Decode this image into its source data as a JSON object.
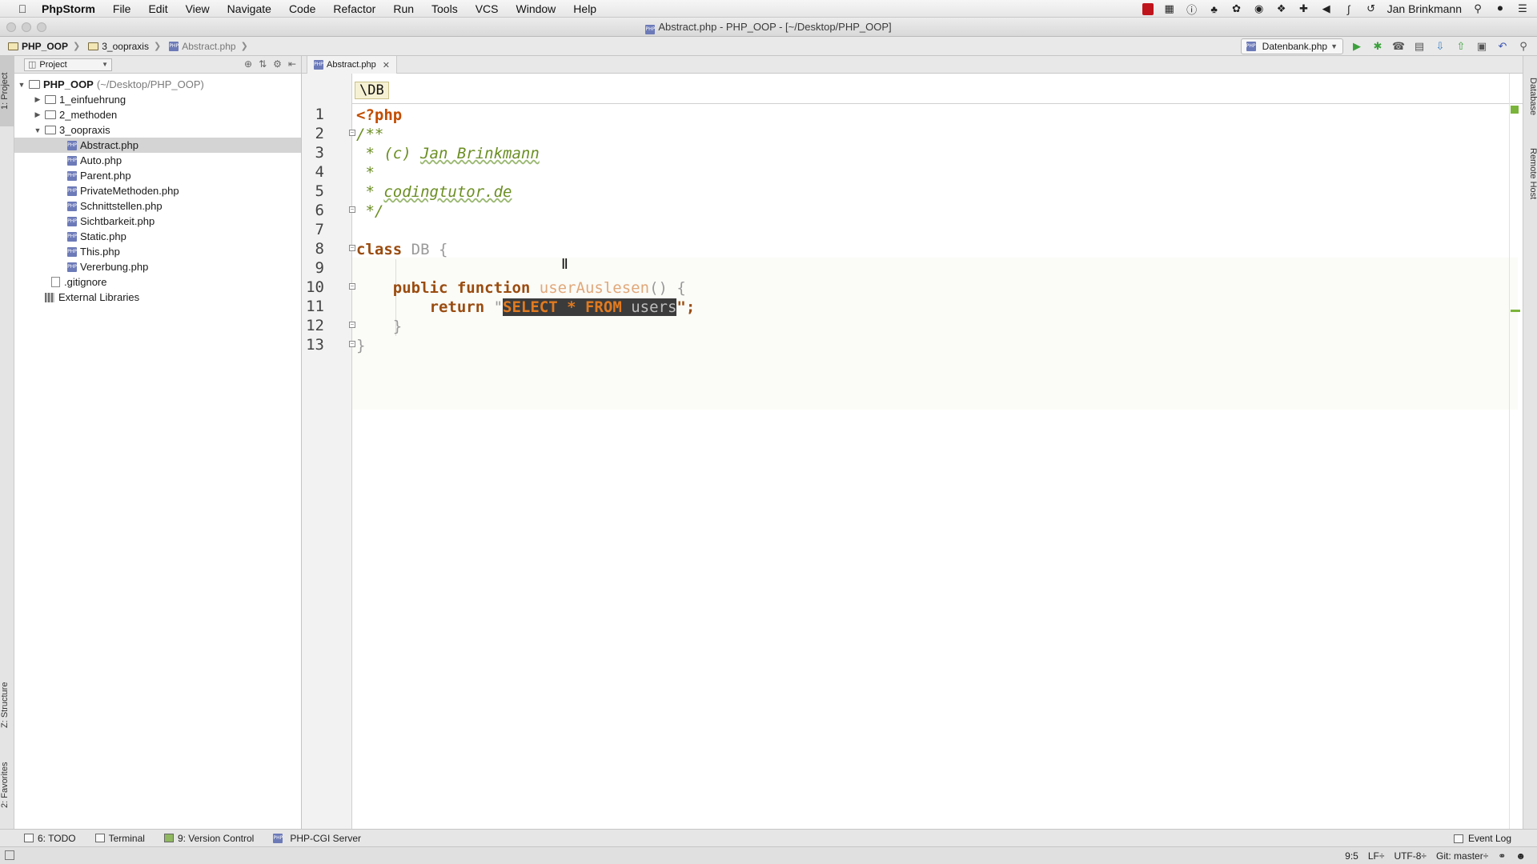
{
  "menubar": {
    "app_name": "PhpStorm",
    "items": [
      "File",
      "Edit",
      "View",
      "Navigate",
      "Code",
      "Refactor",
      "Run",
      "Tools",
      "VCS",
      "Window",
      "Help"
    ],
    "user": "Jan Brinkmann"
  },
  "window": {
    "title": "Abstract.php - PHP_OOP - [~/Desktop/PHP_OOP]"
  },
  "navbar": {
    "breadcrumb": [
      "PHP_OOP",
      "3_oopraxis",
      "Abstract.php"
    ],
    "run_config": "Datenbank.php"
  },
  "tool_windows": {
    "left_top": "1: Project",
    "left_structure": "Z: Structure",
    "left_favorites": "2: Favorites",
    "right_database": "Database",
    "right_remote": "Remote Host"
  },
  "project_panel": {
    "view_selector": "Project",
    "root_name": "PHP_OOP",
    "root_path": "(~/Desktop/PHP_OOP)",
    "folders": [
      "1_einfuehrung",
      "2_methoden",
      "3_oopraxis"
    ],
    "files": [
      "Abstract.php",
      "Auto.php",
      "Parent.php",
      "PrivateMethoden.php",
      "Schnittstellen.php",
      "Sichtbarkeit.php",
      "Static.php",
      "This.php",
      "Vererbung.php"
    ],
    "gitignore": ".gitignore",
    "external_libraries": "External Libraries"
  },
  "editor": {
    "tab_label": "Abstract.php",
    "scope_breadcrumb": "\\DB",
    "line_numbers": [
      "1",
      "2",
      "3",
      "4",
      "5",
      "6",
      "7",
      "8",
      "9",
      "10",
      "11",
      "12",
      "13"
    ],
    "code": {
      "l1": "<?php",
      "l2": "/**",
      "l3_prefix": " * (c) ",
      "l3_name": "Jan Brinkmann",
      "l4": " *",
      "l5_prefix": " * ",
      "l5_site": "codingtutor.de",
      "l6": " */",
      "l8_kw": "class",
      "l8_name": " DB",
      "l8_brace": " {",
      "l10_kw": "    public function",
      "l10_fn": " userAuslesen",
      "l10_rest": "() {",
      "l11_kw": "        return",
      "l11_q1": " \"",
      "l11_sql": "SELECT * FROM",
      "l11_tbl": " users",
      "l11_q2": "\";",
      "l12": "    }",
      "l13": "}"
    }
  },
  "bottom_bar": {
    "todo": "6: TODO",
    "terminal": "Terminal",
    "version_control": "9: Version Control",
    "php_cgi": "PHP-CGI Server",
    "event_log": "Event Log"
  },
  "status_bar": {
    "position": "9:5",
    "line_sep": "LF÷",
    "encoding": "UTF-8÷",
    "vcs": "Git: master÷"
  },
  "colors": {
    "php_open_tag": "#c24d00",
    "comment": "#6b8e23",
    "keyword": "#9a4c10",
    "sql_highlight_bg": "#3b3b3b",
    "sql_keyword": "#e27a1f"
  }
}
